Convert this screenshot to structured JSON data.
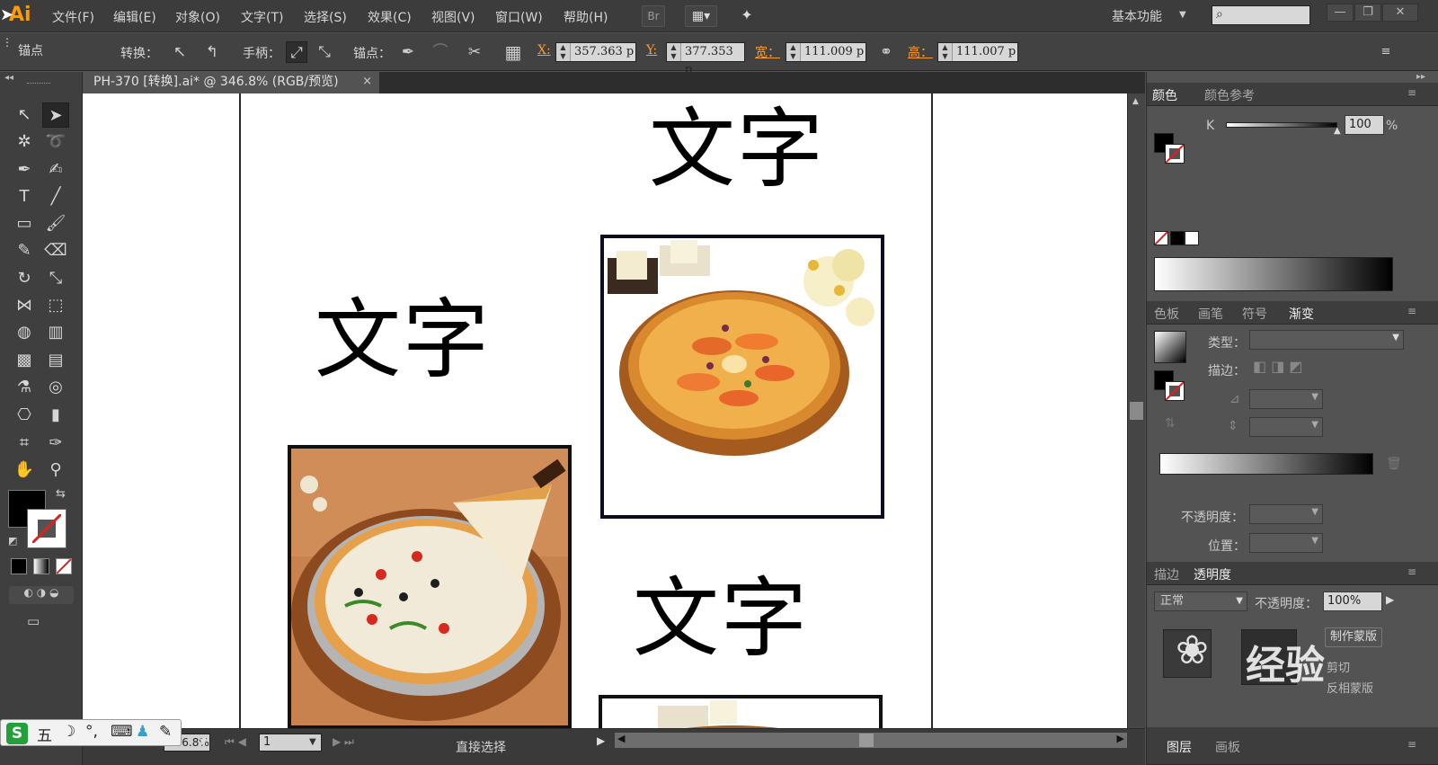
{
  "menubar": {
    "app_logo": "Ai",
    "items": [
      "文件(F)",
      "编辑(E)",
      "对象(O)",
      "文字(T)",
      "选择(S)",
      "效果(C)",
      "视图(V)",
      "窗口(W)",
      "帮助(H)"
    ],
    "bridge_button": "Br",
    "workspace": "基本功能",
    "search_placeholder": "",
    "window_buttons": [
      "—",
      "❐",
      "✕"
    ]
  },
  "controlbar": {
    "selection_label": "锚点",
    "convert_label": "转换：",
    "handles_label": "手柄：",
    "anchor_label": "锚点：",
    "x_label": "X:",
    "x_value": "357.363 p",
    "y_label": "Y:",
    "y_value": "377.353 p",
    "w_label": "宽：",
    "w_value": "111.009 p",
    "h_label": "高：",
    "h_value": "111.007 p"
  },
  "document": {
    "tab_title": "PH-370 [转换].ai* @ 346.8% (RGB/预览)",
    "tab_close": "×"
  },
  "canvas": {
    "texts": [
      "文字",
      "文字",
      "文字"
    ]
  },
  "status": {
    "zoom": "346.8%",
    "page": "1",
    "tool": "直接选择"
  },
  "color_panel": {
    "tabs": [
      "颜色",
      "颜色参考"
    ],
    "channel": "K",
    "value": "100",
    "unit": "%"
  },
  "gradient_panel": {
    "tabs": [
      "色板",
      "画笔",
      "符号",
      "渐变"
    ],
    "type_label": "类型：",
    "stroke_label": "描边：",
    "opacity_label": "不透明度：",
    "position_label": "位置："
  },
  "transparency_panel": {
    "tabs": [
      "描边",
      "透明度"
    ],
    "mode": "正常",
    "opacity_label": "不透明度：",
    "opacity_value": "100%",
    "make_mask": "制作蒙版",
    "clip": "剪切",
    "invert_mask": "反相蒙版"
  },
  "layers_panel": {
    "tabs": [
      "图层",
      "画板"
    ]
  },
  "ime": {
    "items": [
      "S",
      "五",
      "☽",
      "°,",
      "⌨",
      "♟",
      "✎"
    ]
  },
  "watermark": "经验",
  "colors": {
    "accent_orange": "#ff9a00",
    "panel_bg": "#535353",
    "menubar_bg": "#3c3c3c"
  }
}
